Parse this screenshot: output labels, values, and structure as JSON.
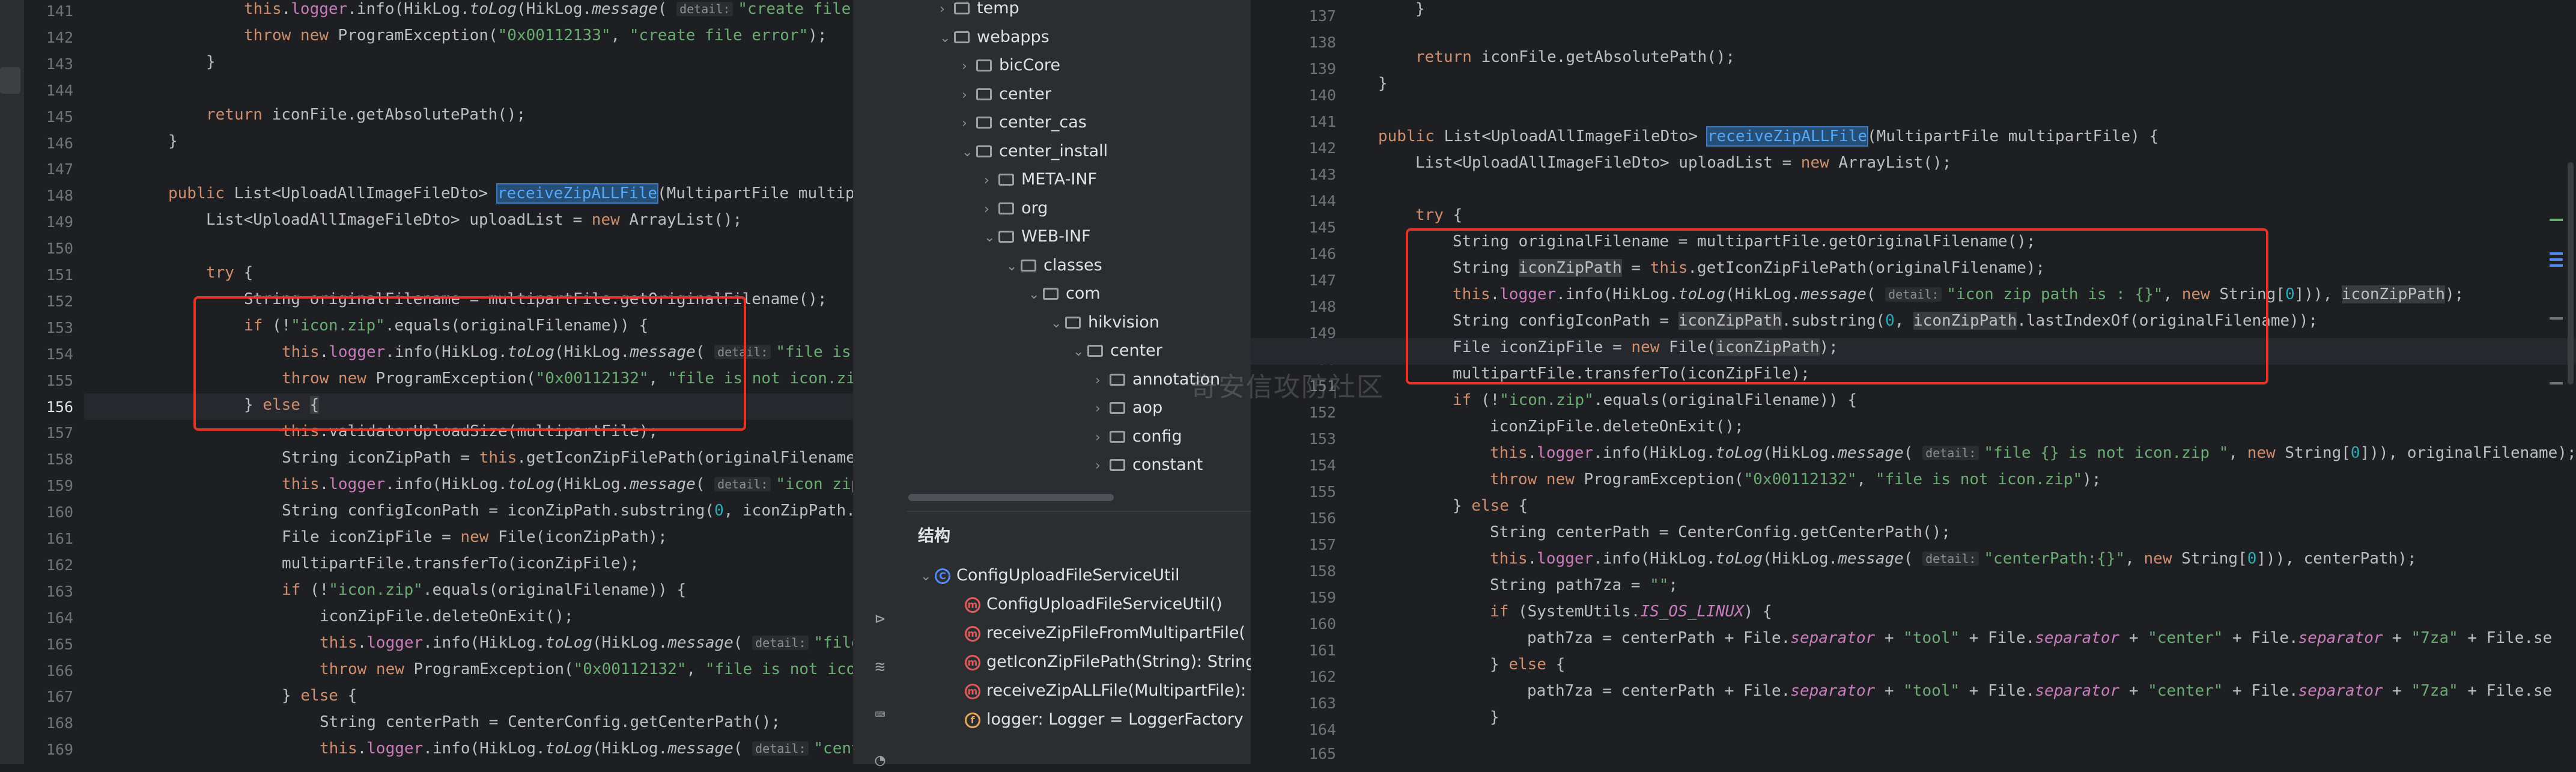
{
  "colors": {
    "editor_bg": "#1e1f22",
    "panel_bg": "#2b2d30",
    "keyword": "#cf8e6d",
    "string": "#6aab73",
    "field": "#c77dbb",
    "method": "#56a8f5",
    "annotation_box": "#e53326"
  },
  "left_editor": {
    "line_numbers": [
      "141",
      "142",
      "143",
      "144",
      "145",
      "146",
      "147",
      "148",
      "149",
      "150",
      "151",
      "152",
      "153",
      "154",
      "155",
      "156",
      "157",
      "158",
      "159",
      "160",
      "161",
      "162",
      "163",
      "164",
      "165",
      "166",
      "167",
      "168",
      "169"
    ],
    "current_line": "156"
  },
  "project_tree": {
    "items": [
      "temp",
      "webapps",
      "bicCore",
      "center",
      "center_cas",
      "center_install",
      "META-INF",
      "org",
      "WEB-INF",
      "classes",
      "com",
      "hikvision",
      "center",
      "annotation",
      "aop",
      "config",
      "constant"
    ]
  },
  "structure": {
    "title": "结构",
    "class_name": "ConfigUploadFileServiceUtil",
    "members": [
      "ConfigUploadFileServiceUtil()",
      "receiveZipFileFromMultipartFile(",
      "getIconZipFilePath(String): String",
      "receiveZipALLFile(MultipartFile):",
      "logger: Logger = LoggerFactory"
    ]
  },
  "right_editor": {
    "line_numbers": [
      "137",
      "138",
      "139",
      "140",
      "141",
      "142",
      "143",
      "144",
      "145",
      "146",
      "147",
      "148",
      "149",
      "150",
      "151",
      "152",
      "153",
      "154",
      "155",
      "156",
      "157",
      "158",
      "159",
      "160",
      "161",
      "162",
      "163",
      "164",
      "165"
    ],
    "current_line": "150"
  },
  "watermark": "奇安信攻防社区"
}
